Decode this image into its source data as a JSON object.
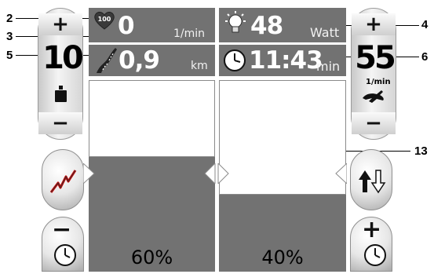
{
  "callouts": {
    "c2": "2",
    "c3": "3",
    "c4": "4",
    "c5": "5",
    "c6": "6",
    "c13": "13"
  },
  "heart_badge": "100",
  "left_stepper": {
    "plus": "+",
    "minus": "−",
    "value": "10"
  },
  "right_stepper": {
    "plus": "+",
    "minus": "−",
    "value": "55",
    "unit": "1/min"
  },
  "pulse": {
    "value": "0",
    "unit": "1/min"
  },
  "power": {
    "value": "48",
    "unit": "Watt"
  },
  "distance": {
    "value": "0,9",
    "unit": "km"
  },
  "time": {
    "value": "11:43",
    "unit": "min"
  },
  "bars": {
    "left_percent_label": "60%",
    "right_percent_label": "40%",
    "left_level": 0.6,
    "right_level": 0.4
  },
  "timer_buttons": {
    "minus": "−",
    "plus": "+"
  },
  "colors": {
    "header_bg": "#727272",
    "bar_fill": "#727272",
    "panel_light": "#f4f4f4"
  }
}
